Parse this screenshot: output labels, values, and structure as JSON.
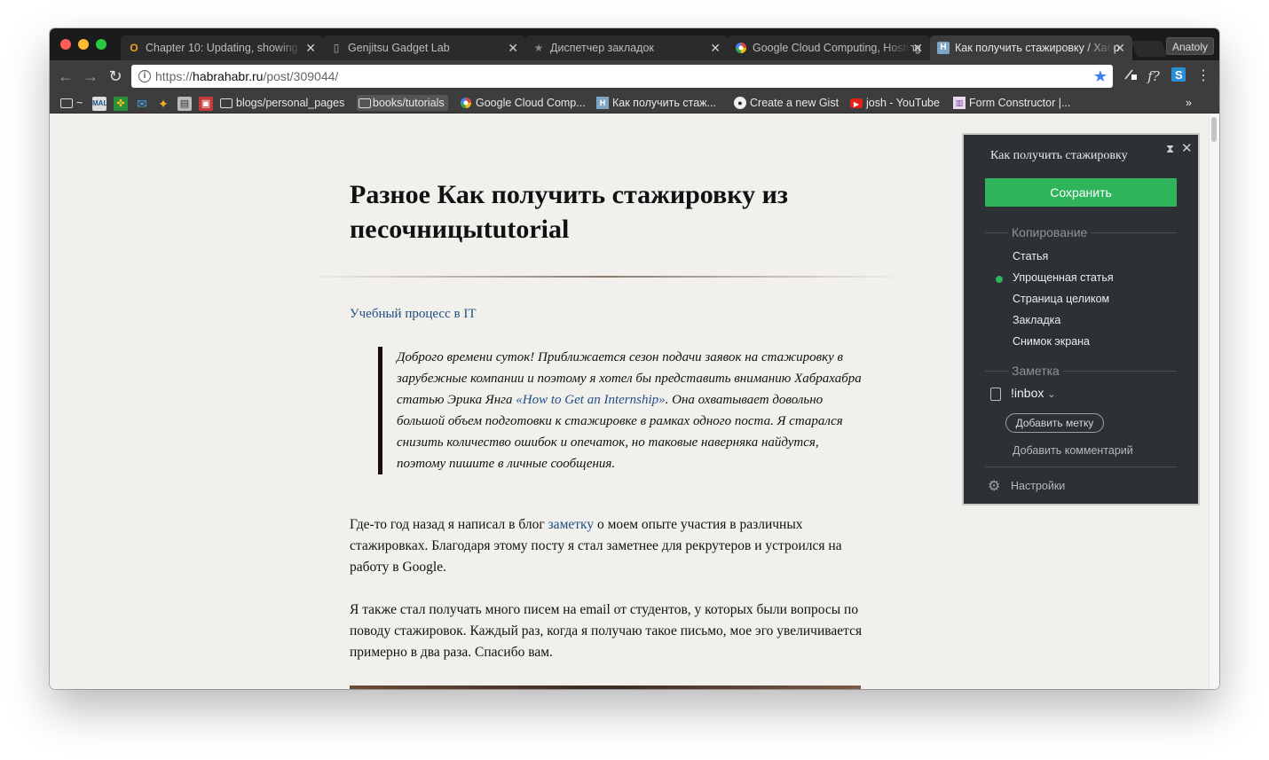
{
  "browser": {
    "tabs": [
      {
        "title": "Chapter 10: Updating, showing",
        "icon": "o-logo-icon",
        "color": "#f0a020"
      },
      {
        "title": "Genjitsu Gadget Lab",
        "icon": "page-icon"
      },
      {
        "title": "Диспетчер закладок",
        "icon": "star-icon"
      },
      {
        "title": "Google Cloud Computing, Hosting",
        "icon": "google-cloud-icon"
      },
      {
        "title": "Как получить стажировку / Хабр",
        "icon": "habr-icon",
        "active": true
      }
    ],
    "profile": "Anatoly",
    "url": {
      "scheme": "https://",
      "host": "habrahabr.ru",
      "path": "/post/309044/"
    },
    "bookmarks": [
      {
        "label": "~",
        "type": "folder"
      },
      {
        "label": "blogs/personal_pages",
        "type": "folder"
      },
      {
        "label": "books/tutorials",
        "type": "folder",
        "pressed": true
      },
      {
        "label": "Google Cloud Comp...",
        "type": "link",
        "icon": "google-cloud-icon"
      },
      {
        "label": "Как получить стаж...",
        "type": "link",
        "icon": "habr-icon"
      },
      {
        "label": "Create a new Gist",
        "type": "link",
        "icon": "github-icon"
      },
      {
        "label": "josh - YouTube",
        "type": "link",
        "icon": "youtube-icon"
      },
      {
        "label": "Form Constructor |...",
        "type": "link",
        "icon": "trello-icon"
      }
    ],
    "bookmark_more": "»"
  },
  "article": {
    "title": "Разное Как получить стажировку из песочницыtutorial",
    "hub": "Учебный процесс в IT",
    "quote_before_link": "Доброго времени суток! Приближается сезон подачи заявок на стажировку в зарубежные компании и поэтому я хотел бы представить вниманию Хабрахабра статью Эрика Янга ",
    "quote_link": "«How to Get an Internship»",
    "quote_after_link": ". Она охватывает довольно большой объем подготовки к стажировке в рамках одного поста. Я старался снизить количество ошибок и опечаток, но таковые наверняка найдутся, поэтому пишите в личные сообщения.",
    "para1_before_link": "Где-то год назад я написал в блог ",
    "para1_link": "заметку",
    "para1_after_link": " о моем опыте участия в различных стажировках. Благодаря этому посту я стал заметнее для рекрутеров и устроился на работу в Google.",
    "para2": "Я также стал получать много писем на email от студентов, у которых были вопросы по поводу стажировок. Каждый раз, когда я получаю такое письмо, мое эго увеличивается примерно в два раза. Спасибо вам."
  },
  "clipper": {
    "title": "Как получить стажировку",
    "save_label": "Сохранить",
    "copy_section": "Копирование",
    "options": [
      "Статья",
      "Упрощенная статья",
      "Страница целиком",
      "Закладка",
      "Снимок экрана"
    ],
    "selected_option": 1,
    "note_section": "Заметка",
    "notebook": "!inbox",
    "add_tag": "Добавить метку",
    "add_comment": "Добавить комментарий",
    "settings": "Настройки",
    "accent_color": "#2fb35b"
  }
}
